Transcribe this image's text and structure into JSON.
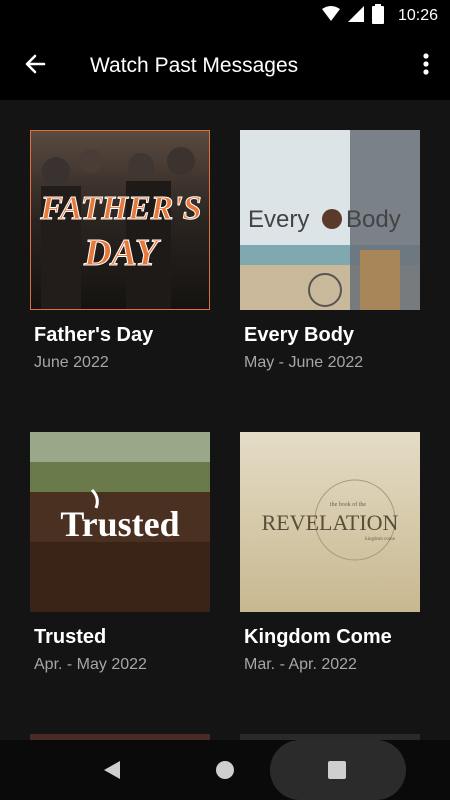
{
  "status_bar": {
    "time": "10:26"
  },
  "app_bar": {
    "title": "Watch Past Messages"
  },
  "series": [
    {
      "title": "Father's Day",
      "date": "June 2022",
      "art_text_line1": "FATHER'S",
      "art_text_line2": "DAY"
    },
    {
      "title": "Every Body",
      "date": "May - June 2022",
      "art_text_left": "Every",
      "art_text_right": "Body"
    },
    {
      "title": "Trusted",
      "date": "Apr. - May 2022",
      "art_text": "Trusted"
    },
    {
      "title": "Kingdom Come",
      "date": "Mar. - Apr. 2022",
      "art_text_small_top": "the book of the",
      "art_text": "REVELATION",
      "art_text_small_bottom": "kingdom come"
    }
  ],
  "colors": {
    "background": "#141414",
    "app_bar": "#000000",
    "selected_border": "#e0703a",
    "secondary_text": "#a6a6a6"
  },
  "icons": [
    "wifi-icon",
    "signal-icon",
    "battery-icon",
    "arrow-back-icon",
    "more-vert-icon",
    "nav-back-icon",
    "nav-home-icon",
    "nav-recents-icon"
  ]
}
